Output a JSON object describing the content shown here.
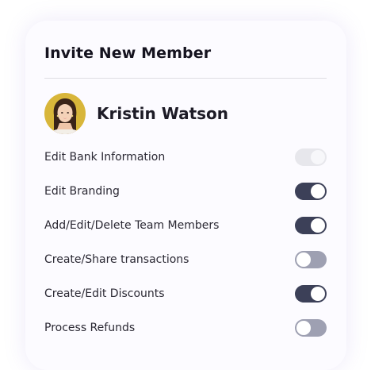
{
  "card": {
    "title": "Invite New Member"
  },
  "user": {
    "name": "Kristin Watson",
    "avatar_icon": "user-avatar-photo"
  },
  "permissions": [
    {
      "label": "Edit Bank Information",
      "state": "on",
      "disabled": true
    },
    {
      "label": "Edit Branding",
      "state": "on",
      "disabled": false
    },
    {
      "label": "Add/Edit/Delete Team Members",
      "state": "on",
      "disabled": false
    },
    {
      "label": "Create/Share transactions",
      "state": "off",
      "disabled": false
    },
    {
      "label": "Create/Edit Discounts",
      "state": "on",
      "disabled": false
    },
    {
      "label": "Process Refunds",
      "state": "off",
      "disabled": false
    }
  ],
  "colors": {
    "toggle_on": "#3c4058",
    "toggle_off": "#9ea0b2",
    "toggle_disabled": "#e7e7ec",
    "avatar_bg": "#d8b63a"
  }
}
